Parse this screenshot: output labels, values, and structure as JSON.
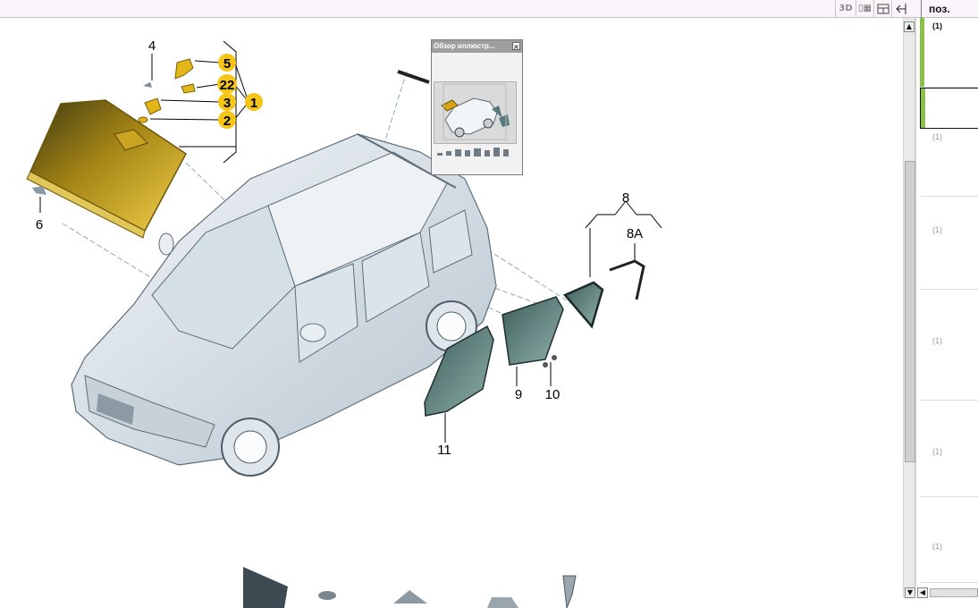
{
  "toolbar": {
    "btn_3d": "3D",
    "icons": [
      "frames-icon",
      "window-icon",
      "back-arrow-icon"
    ]
  },
  "pos_panel": {
    "header": "поз.",
    "rows": [
      "(1)",
      "(1)",
      "(1)",
      "(1)",
      "(1)",
      "(1)"
    ]
  },
  "overview_popup": {
    "title": "Обзор иллюстр..."
  },
  "callouts": {
    "windshield": "1",
    "glass_strip": "2",
    "mirror_base": "3",
    "clip": "4",
    "cover": "5",
    "bracket": "22",
    "sensor": "6",
    "quarter_window": "8",
    "quarter_seal": "8A",
    "rear_door_window": "9",
    "door_clips": "10",
    "front_door_window": "11"
  },
  "colors": {
    "callout_yellow": "#f5c518",
    "glass_gold": "#d9a514",
    "glass_tint": "#567a7a",
    "accent_green": "#8ac14b"
  }
}
